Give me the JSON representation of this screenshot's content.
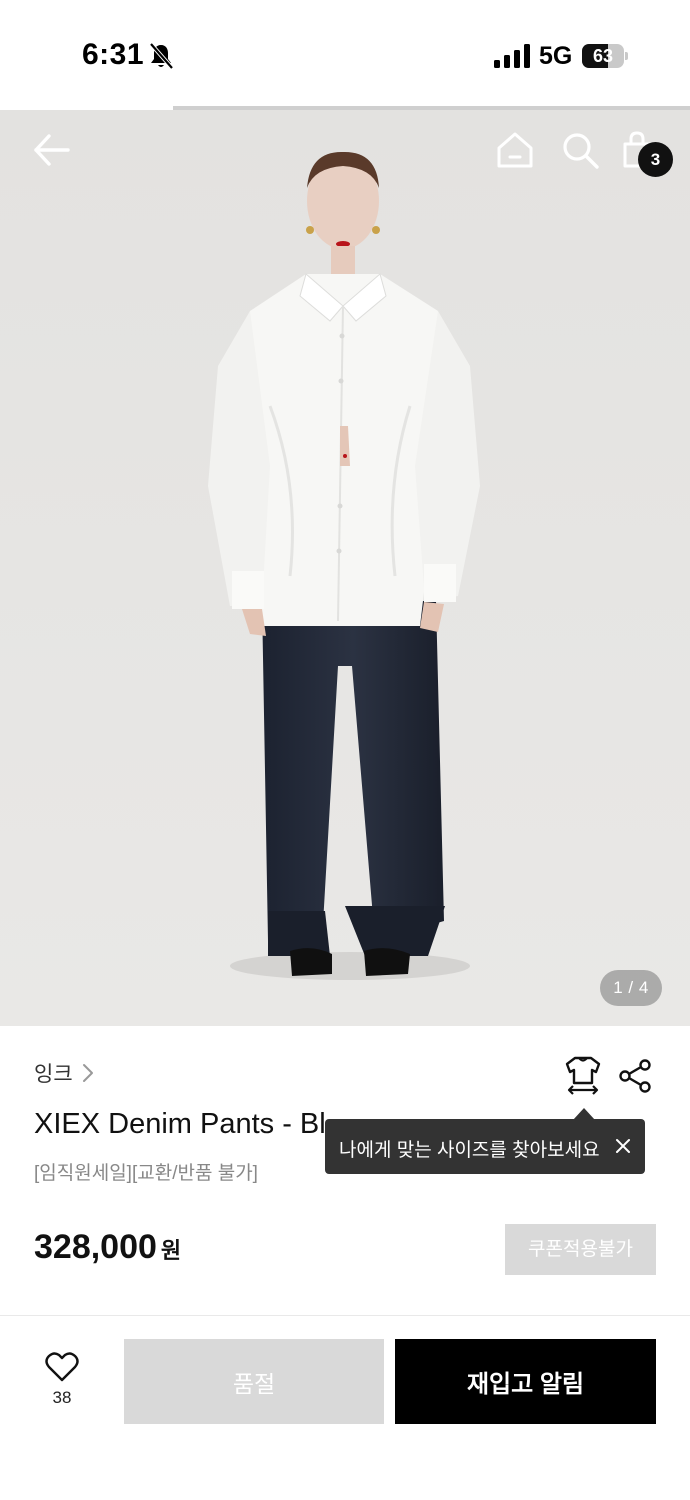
{
  "status_bar": {
    "time": "6:31",
    "network": "5G",
    "battery": "63",
    "battery_level": 0.63,
    "icons": [
      "bell-slash-icon",
      "signal-icon",
      "battery-icon"
    ]
  },
  "gallery": {
    "current_image": "1 / 4",
    "progress_fraction": 0.25
  },
  "header": {
    "icons": [
      "back-arrow-icon",
      "home-icon",
      "search-icon",
      "shopping-bag-icon"
    ],
    "cart_count": "3"
  },
  "product": {
    "brand": "잉크",
    "title": "XIEX Denim Pants - Bl",
    "subtitle": "[임직원세일][교환/반품 불가]",
    "price": "328,000",
    "currency": "원",
    "coupon_label": "쿠폰적용불가"
  },
  "tooltip": {
    "text": "나에게 맞는 사이즈를 찾아보세요"
  },
  "actions": {
    "wish_count": "38",
    "soldout_label": "품절",
    "restock_label": "재입고 알림"
  },
  "colors": {
    "accent": "#000000",
    "disabled": "#d9d9d9",
    "tooltip_bg": "#333333",
    "hero_bg": "#e5e4e2"
  }
}
